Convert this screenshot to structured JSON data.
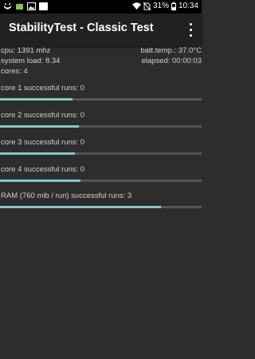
{
  "status_bar": {
    "battery": "31%",
    "time": "10:34",
    "icons": [
      "smile-notification-icon",
      "android-notification-icon",
      "image-notification-icon",
      "blank-notification-icon",
      "wifi-icon",
      "no-sim-icon",
      "battery-icon"
    ]
  },
  "toolbar": {
    "title": "StabilityTest - Classic Test",
    "menu_icon": "overflow-menu-icon"
  },
  "info": {
    "cpu": "cpu: 1391 mhz",
    "batt_temp": "batt.temp.: 37.0°C",
    "system_load": "system load: 8.34",
    "elapsed": "elapsed: 00:00:03",
    "cores": "cores: 4"
  },
  "runs": [
    {
      "label": "core 1 successful runs: 0",
      "progress": 0.36
    },
    {
      "label": "core 2 successful runs: 0",
      "progress": 0.39
    },
    {
      "label": "core 3 successful runs: 0",
      "progress": 0.37
    },
    {
      "label": "core 4 successful runs: 0",
      "progress": 0.4
    },
    {
      "label": "RAM (760 mib / run) successful runs: 3",
      "progress": 0.8
    }
  ],
  "colors": {
    "background": "#2d2d2d",
    "toolbar": "#212121",
    "progress_fill": "#80cbc4",
    "progress_track": "#555555"
  }
}
